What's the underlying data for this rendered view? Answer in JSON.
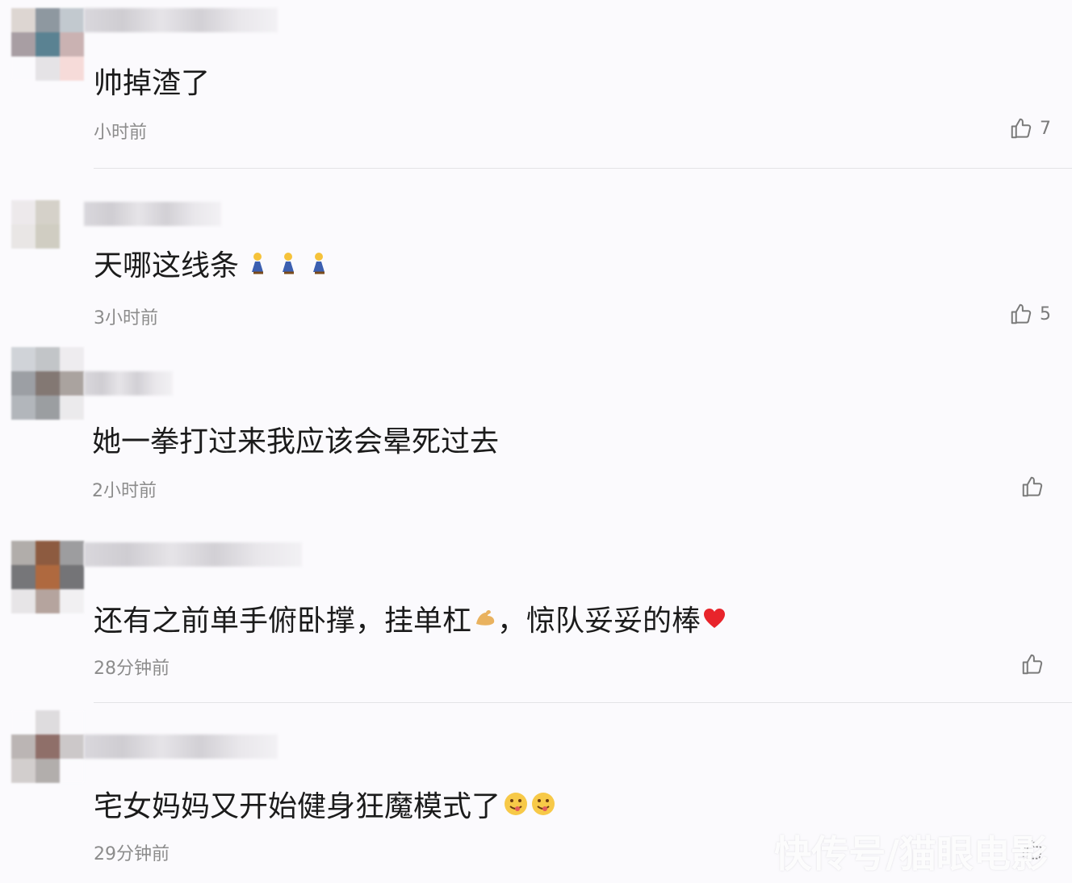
{
  "comments": [
    {
      "text": "帅掉渣了",
      "time": "小时前",
      "likes": "7"
    },
    {
      "text": "天哪这线条",
      "time": "3小时前",
      "likes": "5",
      "emoji": [
        "person-kneeling-icon",
        "person-kneeling-icon",
        "person-kneeling-icon"
      ]
    },
    {
      "text": "她一拳打过来我应该会晕死过去",
      "time": "2小时前",
      "likes": ""
    },
    {
      "text": "还有之前单手俯卧撑，挂单杠",
      "text_after": "，惊队妥妥的棒",
      "time": "28分钟前",
      "likes": "",
      "emoji": [
        "flexed-biceps-icon",
        "red-heart-icon"
      ]
    },
    {
      "text": "宅女妈妈又开始健身狂魔模式了",
      "time": "29分钟前",
      "likes": "",
      "emoji": [
        "yum-face-icon",
        "yum-face-icon"
      ]
    }
  ],
  "watermark": "快传号/猫眼电影",
  "colors": {
    "background": "#fbfafd",
    "text": "#1b1b1b",
    "muted": "#8c8c8c",
    "heart": "#e8242b"
  }
}
